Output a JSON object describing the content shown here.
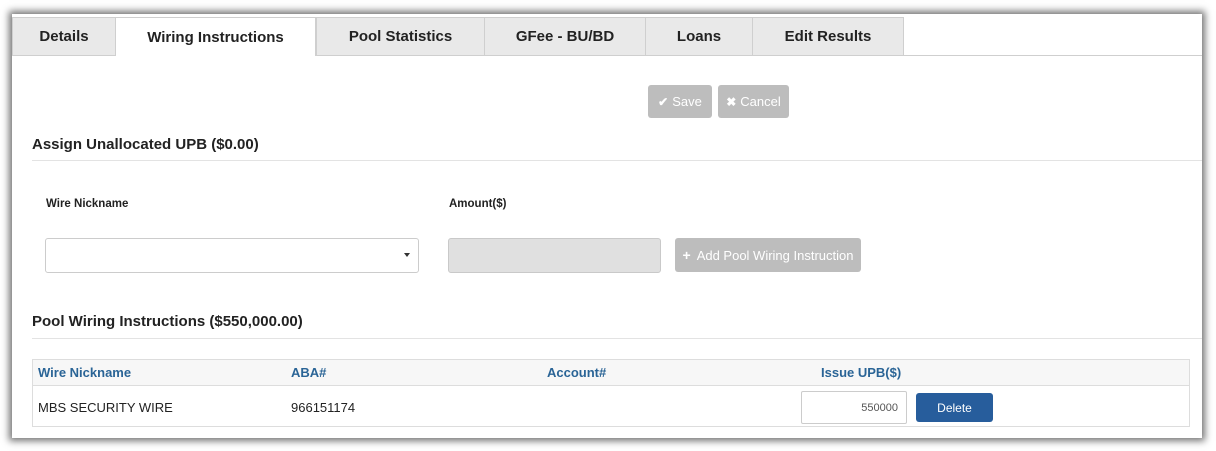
{
  "tabs": [
    {
      "label": "Details"
    },
    {
      "label": "Wiring Instructions",
      "active": true
    },
    {
      "label": "Pool Statistics"
    },
    {
      "label": "GFee - BU/BD"
    },
    {
      "label": "Loans"
    },
    {
      "label": "Edit Results"
    }
  ],
  "toolbar": {
    "save_label": "Save",
    "cancel_label": "Cancel"
  },
  "assign_section": {
    "title": "Assign Unallocated UPB ($0.00)",
    "wire_nickname_label": "Wire Nickname",
    "wire_nickname_value": "",
    "amount_label": "Amount($)",
    "amount_value": "",
    "add_button_label": "Add Pool Wiring Instruction"
  },
  "pool_section": {
    "title": "Pool Wiring Instructions ($550,000.00)",
    "columns": [
      "Wire Nickname",
      "ABA#",
      "Account#",
      "Issue UPB($)"
    ],
    "rows": [
      {
        "wire_nickname": "MBS SECURITY WIRE",
        "aba": "966151174",
        "account": "",
        "issue_upb": "550000",
        "delete_label": "Delete"
      }
    ]
  },
  "colors": {
    "accent_blue": "#275d9c",
    "header_link_blue": "#2a6496",
    "disabled_gray": "#bdbdbd"
  }
}
